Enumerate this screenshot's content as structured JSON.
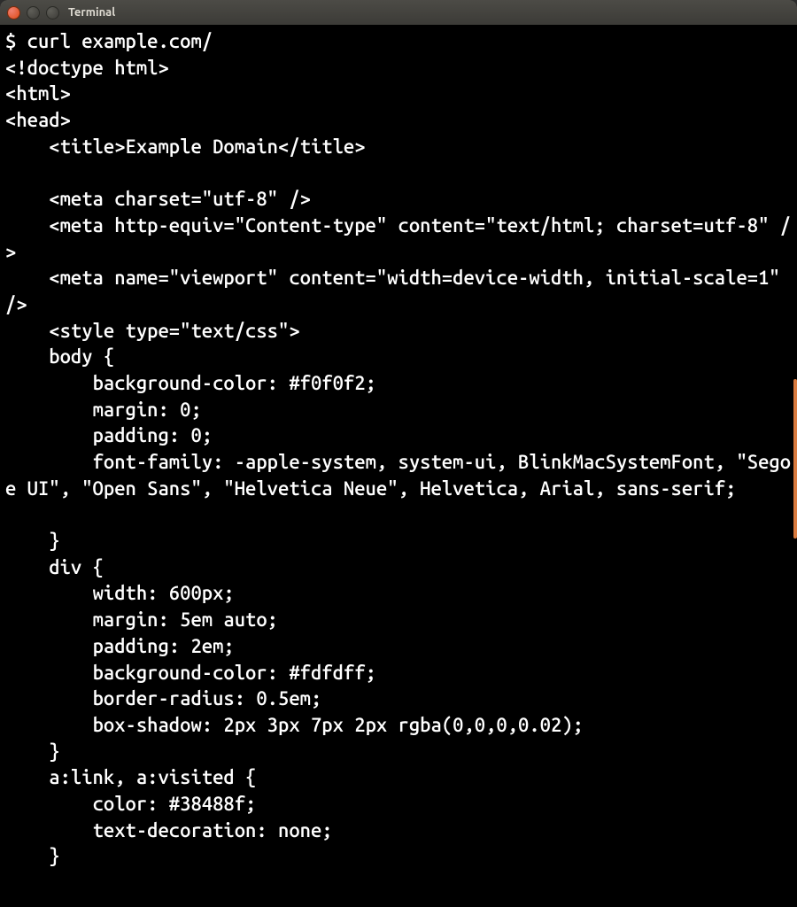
{
  "window": {
    "title": "Terminal"
  },
  "terminal": {
    "prompt": "$ ",
    "command": "curl example.com/",
    "output": "<!doctype html>\n<html>\n<head>\n    <title>Example Domain</title>\n\n    <meta charset=\"utf-8\" />\n    <meta http-equiv=\"Content-type\" content=\"text/html; charset=utf-8\" />\n    <meta name=\"viewport\" content=\"width=device-width, initial-scale=1\" />\n    <style type=\"text/css\">\n    body {\n        background-color: #f0f0f2;\n        margin: 0;\n        padding: 0;\n        font-family: -apple-system, system-ui, BlinkMacSystemFont, \"Segoe UI\", \"Open Sans\", \"Helvetica Neue\", Helvetica, Arial, sans-serif;\n        \n    }\n    div {\n        width: 600px;\n        margin: 5em auto;\n        padding: 2em;\n        background-color: #fdfdff;\n        border-radius: 0.5em;\n        box-shadow: 2px 3px 7px 2px rgba(0,0,0,0.02);\n    }\n    a:link, a:visited {\n        color: #38488f;\n        text-decoration: none;\n    }"
  }
}
